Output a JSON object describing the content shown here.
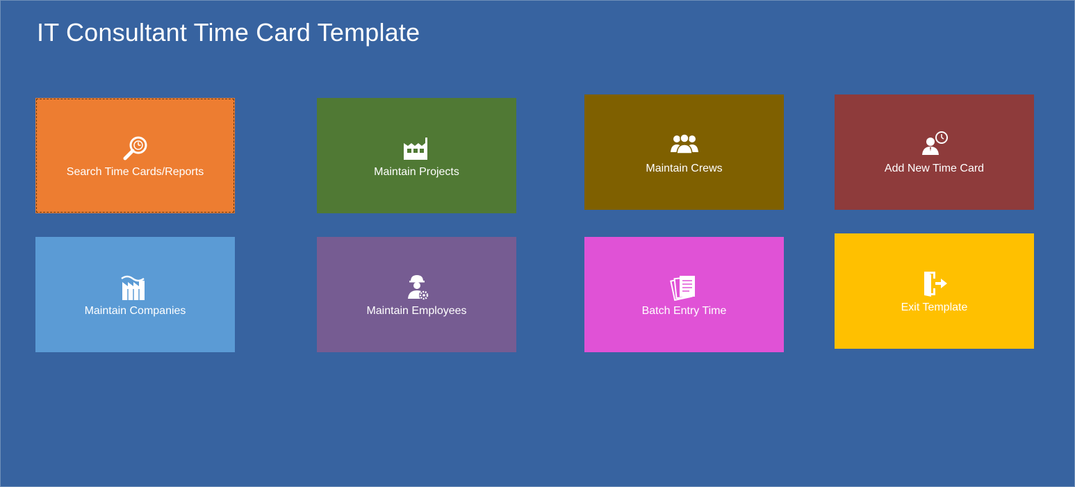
{
  "title": "IT Consultant Time Card Template",
  "tiles": [
    {
      "label": "Search Time Cards/Reports",
      "color": "#ed7d31",
      "icon": "search-clock-icon"
    },
    {
      "label": "Maintain Projects",
      "color": "#507934",
      "icon": "factory-icon"
    },
    {
      "label": "Maintain Crews",
      "color": "#7f6000",
      "icon": "group-icon"
    },
    {
      "label": "Add New Time Card",
      "color": "#8e3b3b",
      "icon": "user-clock-icon"
    },
    {
      "label": "Maintain Companies",
      "color": "#5b9bd5",
      "icon": "company-building-icon"
    },
    {
      "label": "Maintain Employees",
      "color": "#765c92",
      "icon": "worker-gear-icon"
    },
    {
      "label": "Batch Entry Time",
      "color": "#e052d6",
      "icon": "documents-icon"
    },
    {
      "label": "Exit Template",
      "color": "#ffc000",
      "icon": "exit-door-icon"
    }
  ]
}
